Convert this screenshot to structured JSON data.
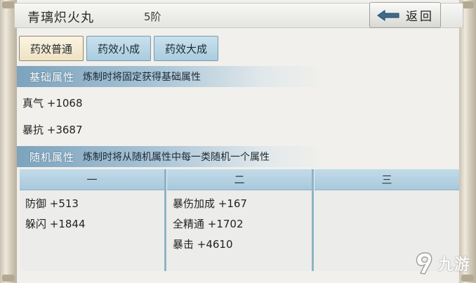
{
  "header": {
    "title": "青璃炽火丸",
    "rank": "5阶",
    "back_label": "返回"
  },
  "tabs": [
    {
      "label": "药效普通",
      "active": true
    },
    {
      "label": "药效小成",
      "active": false
    },
    {
      "label": "药效大成",
      "active": false
    }
  ],
  "base_section": {
    "title": "基础属性",
    "desc": "炼制时将固定获得基础属性",
    "attrs": [
      "真气 +1068",
      "暴抗 +3687"
    ]
  },
  "random_section": {
    "title": "随机属性",
    "desc": "炼制时将从随机属性中每一类随机一个属性",
    "columns": [
      {
        "header": "一",
        "items": [
          "防御 +513",
          "躲闪 +1844"
        ]
      },
      {
        "header": "二",
        "items": [
          "暴伤加成 +167",
          "全精通 +1702",
          "暴击 +4610"
        ]
      },
      {
        "header": "三",
        "items": []
      }
    ]
  },
  "watermark": {
    "text": "九游"
  },
  "colors": {
    "section_bar": "#7da3bd",
    "tab_inactive": "#a9ccdf",
    "tab_active": "#efe2c2",
    "background": "#f1f0ec"
  }
}
